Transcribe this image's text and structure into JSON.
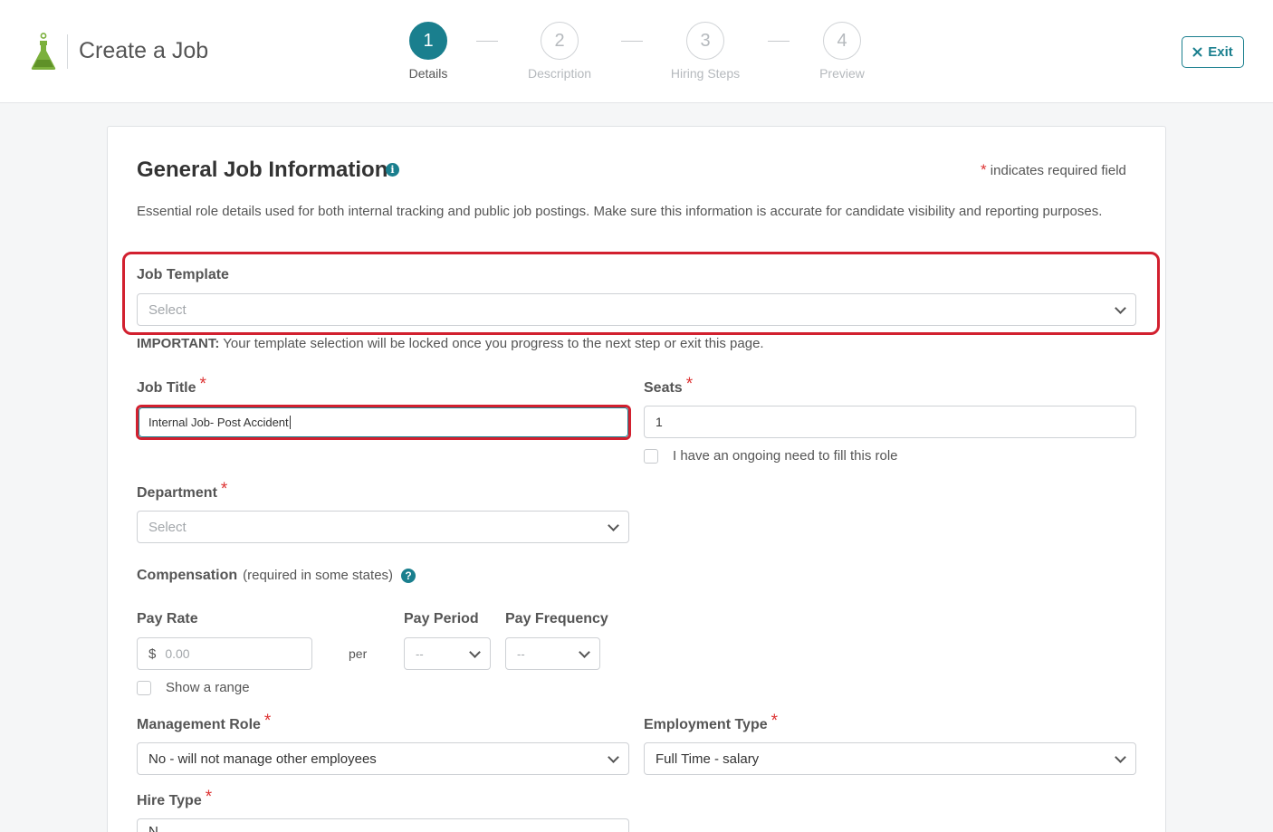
{
  "header": {
    "title": "Create a Job",
    "exit_label": "Exit",
    "steps": [
      {
        "number": "1",
        "label": "Details",
        "active": true
      },
      {
        "number": "2",
        "label": "Description",
        "active": false
      },
      {
        "number": "3",
        "label": "Hiring Steps",
        "active": false
      },
      {
        "number": "4",
        "label": "Preview",
        "active": false
      }
    ]
  },
  "form": {
    "section_title": "General Job Information",
    "required_note": "indicates required field",
    "description": "Essential role details used for both internal tracking and public job postings. Make sure this information is accurate for candidate visibility and reporting purposes.",
    "job_template": {
      "label": "Job Template",
      "placeholder": "Select"
    },
    "important_prefix": "IMPORTANT:",
    "important_text": " Your template selection will be locked once you progress to the next step or exit this page.",
    "job_title": {
      "label": "Job Title",
      "value": "Internal Job- Post Accident"
    },
    "seats": {
      "label": "Seats",
      "value": "1"
    },
    "ongoing_need": {
      "label": "I have an ongoing need to fill this role",
      "checked": false
    },
    "department": {
      "label": "Department",
      "placeholder": "Select"
    },
    "compensation": {
      "label": "Compensation",
      "note": "(required in some states)"
    },
    "pay_rate": {
      "label": "Pay Rate",
      "currency": "$",
      "placeholder": "0.00"
    },
    "per_label": "per",
    "pay_period": {
      "label": "Pay Period",
      "placeholder": "--"
    },
    "pay_frequency": {
      "label": "Pay Frequency",
      "placeholder": "--"
    },
    "show_range": {
      "label": "Show a range",
      "checked": false
    },
    "management_role": {
      "label": "Management Role",
      "value": "No - will not manage other employees"
    },
    "employment_type": {
      "label": "Employment Type",
      "value": "Full Time - salary"
    },
    "hire_type": {
      "label": "Hire Type",
      "value": "N..."
    },
    "required_mark": "*"
  },
  "colors": {
    "accent": "#1a7f8e",
    "required": "#d33333",
    "highlight": "#d2202f",
    "logo": "#7bb03c"
  }
}
